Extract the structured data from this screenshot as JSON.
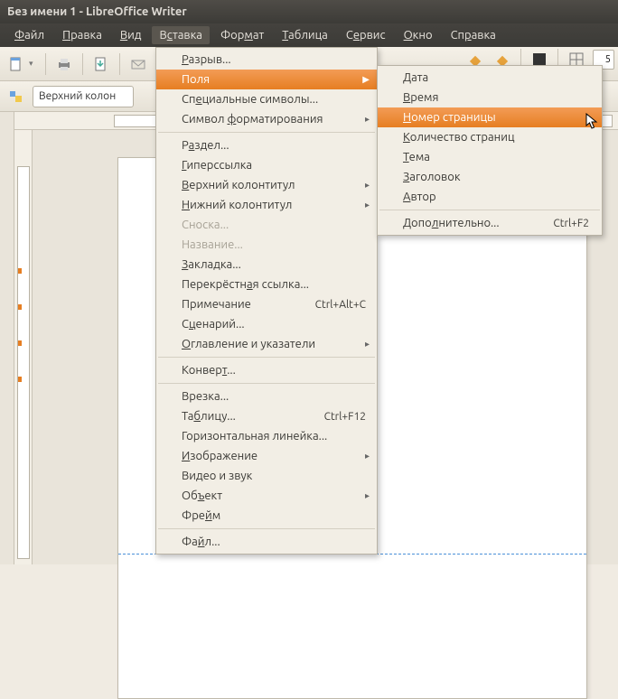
{
  "titlebar": {
    "title": "Без имени 1 - LibreOffice Writer"
  },
  "menubar": {
    "file": {
      "label": "Файл",
      "u": "Ф"
    },
    "edit": {
      "label": "Правка",
      "u": "П"
    },
    "view": {
      "label": "Вид",
      "u": "В"
    },
    "insert": {
      "label": "Вставка",
      "u": "с"
    },
    "format": {
      "label": "Формат",
      "u": "м"
    },
    "table": {
      "label": "Таблица",
      "u": "Т"
    },
    "tools": {
      "label": "Сервис",
      "u": "е"
    },
    "window": {
      "label": "Окно",
      "u": "О"
    },
    "help": {
      "label": "Справка",
      "u": "р"
    }
  },
  "toolbar2": {
    "style_combo": "Верхний колон",
    "right_value": "5"
  },
  "insert_menu": {
    "break": "Разрыв...",
    "fields": "Поля",
    "special": "Специальные символы...",
    "formatting": "Символ форматирования",
    "section": "Раздел...",
    "hyperlink": "Гиперссылка",
    "header": "Верхний колонтитул",
    "footer": "Нижний колонтитул",
    "footnote": "Сноска...",
    "caption": "Название...",
    "bookmark": "Закладка...",
    "crossref": "Перекрёстная ссылка...",
    "comment": "Примечание",
    "comment_sc": "Ctrl+Alt+C",
    "script": "Сценарий...",
    "indexes": "Оглавление и указатели",
    "envelope": "Конверт...",
    "frame": "Врезка...",
    "tablei": "Таблицу...",
    "tablei_sc": "Ctrl+F12",
    "hrule": "Горизонтальная линейка...",
    "image": "Изображение",
    "media": "Видео и звук",
    "object": "Объект",
    "floatframe": "Фрейм",
    "filei": "Файл..."
  },
  "fields_submenu": {
    "date": "Дата",
    "time": "Время",
    "pagenum": "Номер страницы",
    "pagecount": "Количество страниц",
    "subject": "Тема",
    "title": "Заголовок",
    "author": "Автор",
    "other": "Дополнительно...",
    "other_sc": "Ctrl+F2"
  }
}
